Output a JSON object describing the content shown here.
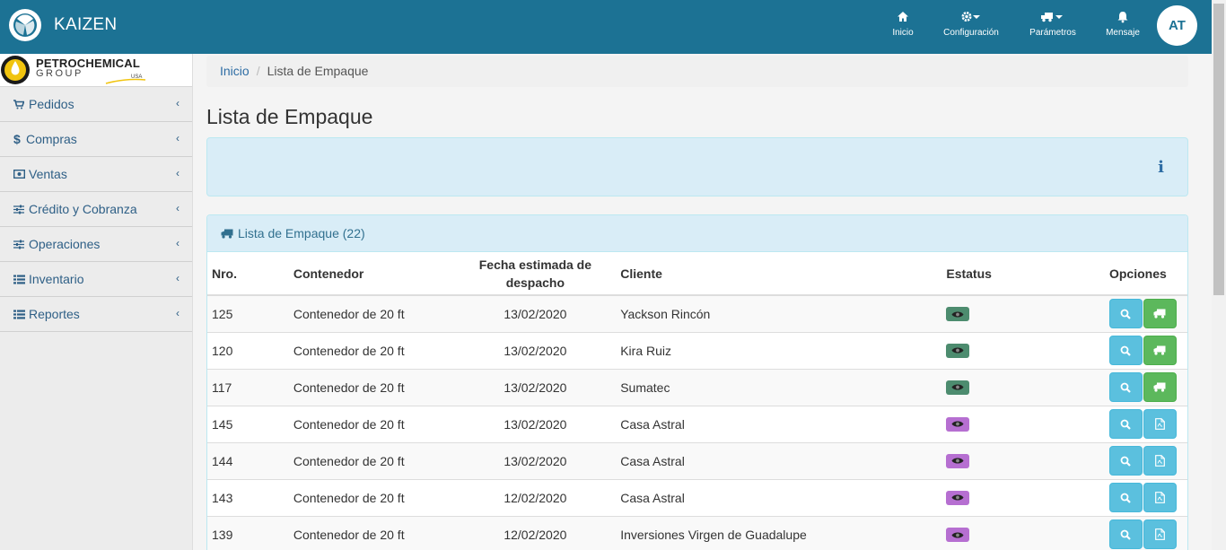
{
  "header": {
    "brand": "KAIZEN",
    "nav": [
      {
        "label": "Inicio",
        "icon": "home-icon"
      },
      {
        "label": "Configuración",
        "icon": "gear-icon"
      },
      {
        "label": "Parámetros",
        "icon": "truck-icon"
      },
      {
        "label": "Mensaje",
        "icon": "bell-icon"
      }
    ],
    "avatar_initials": "AT"
  },
  "sidebar": {
    "company": {
      "name": "PETROCHEMICAL",
      "sub": "GROUP",
      "tag": "USA"
    },
    "items": [
      {
        "label": "Pedidos",
        "icon": "cart-icon"
      },
      {
        "label": "Compras",
        "icon": "dollar-icon"
      },
      {
        "label": "Ventas",
        "icon": "money-icon"
      },
      {
        "label": "Crédito y Cobranza",
        "icon": "sliders-icon"
      },
      {
        "label": "Operaciones",
        "icon": "sliders-icon"
      },
      {
        "label": "Inventario",
        "icon": "list-icon"
      },
      {
        "label": "Reportes",
        "icon": "list-icon"
      }
    ]
  },
  "breadcrumb": {
    "home": "Inicio",
    "current": "Lista de Empaque"
  },
  "page": {
    "title": "Lista de Empaque"
  },
  "panel": {
    "title": "Lista de Empaque (22)"
  },
  "table": {
    "headers": {
      "nro": "Nro.",
      "contenedor": "Contenedor",
      "fecha_l1": "Fecha estimada de",
      "fecha_l2": "despacho",
      "cliente": "Cliente",
      "estatus": "Estatus",
      "opciones": "Opciones"
    },
    "rows": [
      {
        "nro": "125",
        "contenedor": "Contenedor de 20 ft",
        "fecha": "13/02/2020",
        "cliente": "Yackson Rincón",
        "status_color": "#4d8c6f",
        "action": "truck"
      },
      {
        "nro": "120",
        "contenedor": "Contenedor de 20 ft",
        "fecha": "13/02/2020",
        "cliente": "Kira Ruiz",
        "status_color": "#4d8c6f",
        "action": "truck"
      },
      {
        "nro": "117",
        "contenedor": "Contenedor de 20 ft",
        "fecha": "13/02/2020",
        "cliente": "Sumatec",
        "status_color": "#4d8c6f",
        "action": "truck"
      },
      {
        "nro": "145",
        "contenedor": "Contenedor de 20 ft",
        "fecha": "13/02/2020",
        "cliente": "Casa Astral",
        "status_color": "#b66fd1",
        "action": "pdf"
      },
      {
        "nro": "144",
        "contenedor": "Contenedor de 20 ft",
        "fecha": "13/02/2020",
        "cliente": "Casa Astral",
        "status_color": "#b66fd1",
        "action": "pdf"
      },
      {
        "nro": "143",
        "contenedor": "Contenedor de 20 ft",
        "fecha": "12/02/2020",
        "cliente": "Casa Astral",
        "status_color": "#b66fd1",
        "action": "pdf"
      },
      {
        "nro": "139",
        "contenedor": "Contenedor de 20 ft",
        "fecha": "12/02/2020",
        "cliente": "Inversiones Virgen de Guadalupe",
        "status_color": "#b66fd1",
        "action": "pdf"
      }
    ]
  },
  "colors": {
    "topbar": "#1c7294",
    "link": "#2e6da4",
    "info_bg": "#d9edf7",
    "btn_info": "#5bc0de",
    "btn_success": "#5cb85c"
  }
}
